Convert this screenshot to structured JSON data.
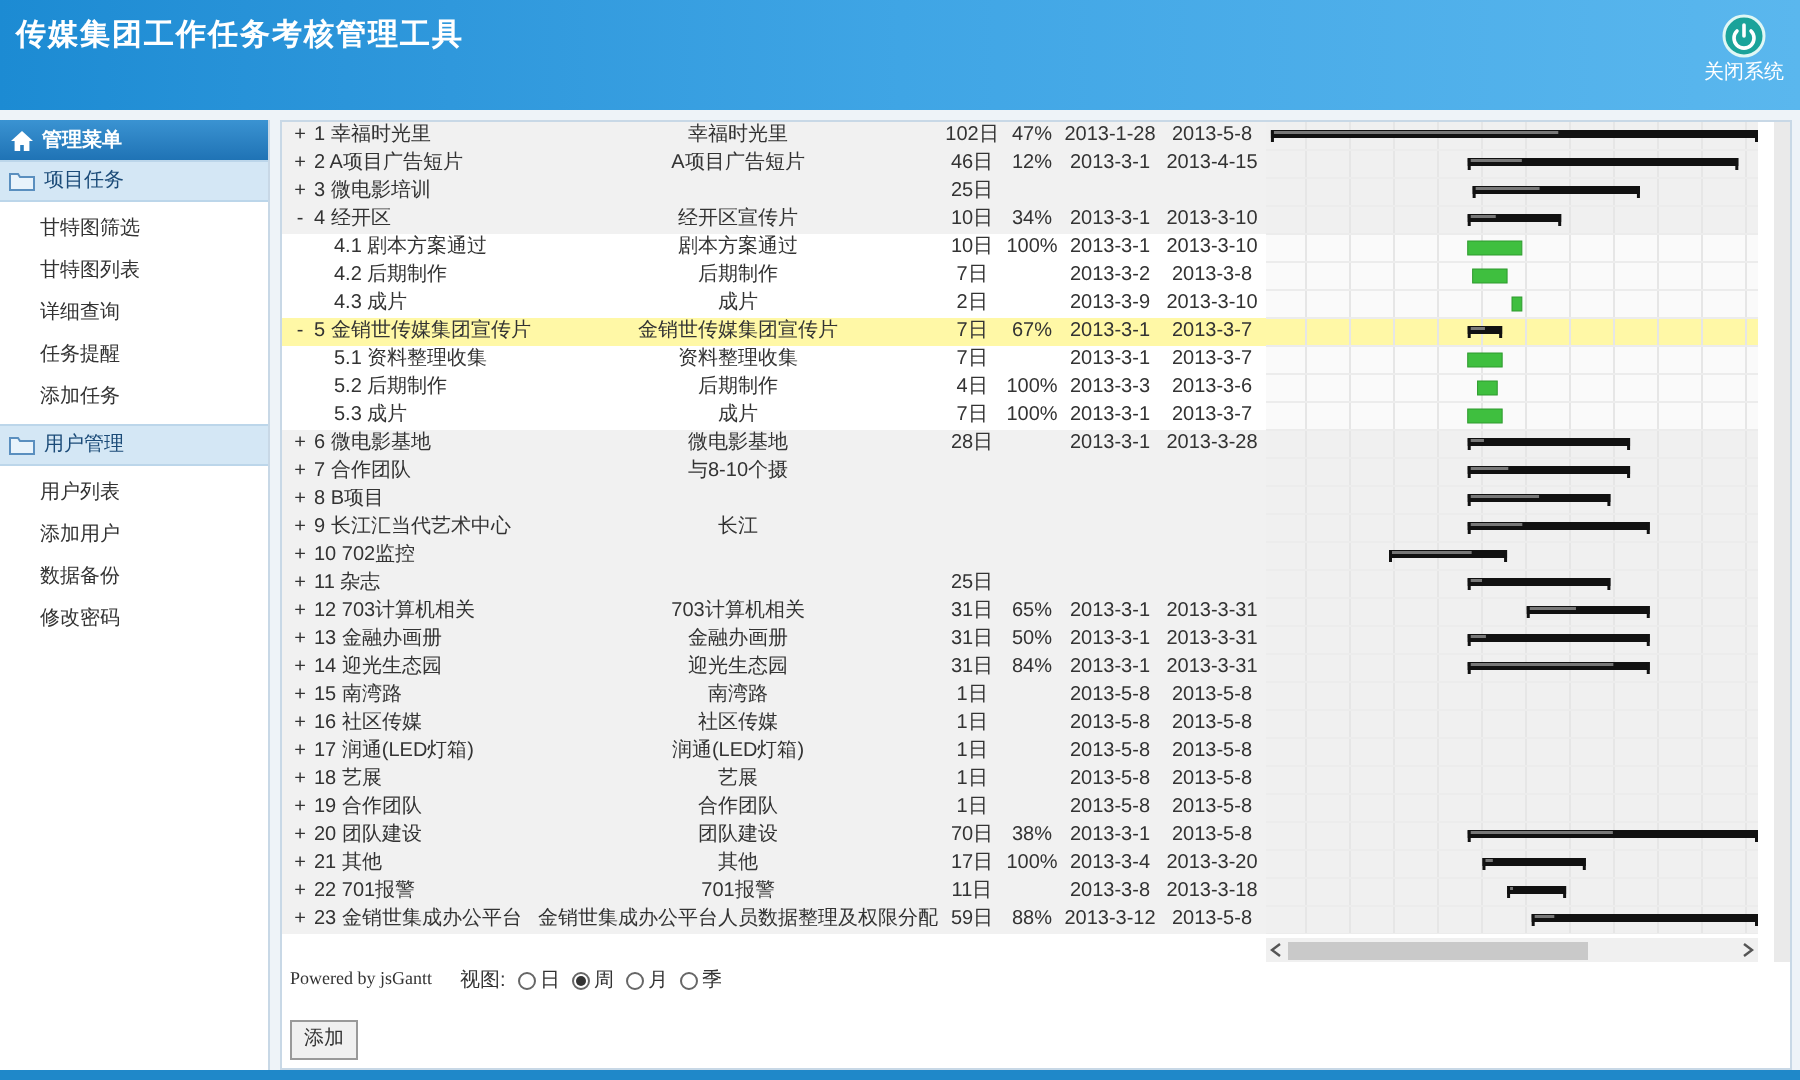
{
  "header": {
    "title": "传媒集团工作任务考核管理工具",
    "close_label": "关闭系统"
  },
  "sidebar": {
    "title": "管理菜单",
    "groups": [
      {
        "title": "项目任务",
        "items": [
          "甘特图筛选",
          "甘特图列表",
          "详细查询",
          "任务提醒",
          "添加任务"
        ]
      },
      {
        "title": "用户管理",
        "items": [
          "用户列表",
          "添加用户",
          "数据备份",
          "修改密码"
        ]
      }
    ]
  },
  "tasks": [
    {
      "toggle": "+",
      "label": "1 幸福时光里",
      "desc": "幸福时光里",
      "duration": "102日",
      "percent": "47%",
      "start": "2013-1-28",
      "end": "2013-5-8",
      "selected": false
    },
    {
      "toggle": "+",
      "label": "2 A项目广告短片",
      "desc": "A项目广告短片",
      "duration": "46日",
      "percent": "12%",
      "start": "2013-3-1",
      "end": "2013-4-15",
      "selected": false
    },
    {
      "toggle": "+",
      "label": "3 微电影培训",
      "duration": "25日",
      "selected": false
    },
    {
      "toggle": "-",
      "label": "4 经开区",
      "desc": "经开区宣传片",
      "duration": "10日",
      "percent": "34%",
      "start": "2013-3-1",
      "end": "2013-3-10",
      "selected": false,
      "children": [
        {
          "label": "4.1 剧本方案通过",
          "desc": "剧本方案通过",
          "duration": "10日",
          "percent": "100%",
          "start": "2013-3-1",
          "end": "2013-3-10",
          "selected": false
        },
        {
          "label": "4.2 后期制作",
          "desc": "后期制作",
          "duration": "7日",
          "start": "2013-3-2",
          "end": "2013-3-8",
          "selected": false
        },
        {
          "label": "4.3 成片",
          "desc": "成片",
          "duration": "2日",
          "start": "2013-3-9",
          "end": "2013-3-10",
          "selected": false
        }
      ]
    },
    {
      "toggle": "-",
      "label": "5 金销世传媒集团宣传片",
      "desc": "金销世传媒集团宣传片",
      "duration": "7日",
      "percent": "67%",
      "start": "2013-3-1",
      "end": "2013-3-7",
      "selected": true,
      "children": [
        {
          "label": "5.1 资料整理收集",
          "desc": "资料整理收集",
          "duration": "7日",
          "start": "2013-3-1",
          "end": "2013-3-7",
          "selected": false
        },
        {
          "label": "5.2 后期制作",
          "desc": "后期制作",
          "duration": "4日",
          "percent": "100%",
          "start": "2013-3-3",
          "end": "2013-3-6",
          "selected": false
        },
        {
          "label": "5.3 成片",
          "desc": "成片",
          "duration": "7日",
          "percent": "100%",
          "start": "2013-3-1",
          "end": "2013-3-7",
          "selected": false
        }
      ]
    },
    {
      "toggle": "+",
      "label": "6 微电影基地",
      "desc": "微电影基地",
      "duration": "28日",
      "start": "2013-3-1",
      "end": "2013-3-28",
      "selected": false
    },
    {
      "toggle": "+",
      "label": "7 合作团队",
      "desc": "与8-10个摄",
      "selected": false
    },
    {
      "toggle": "+",
      "label": "8 B项目",
      "selected": false
    },
    {
      "toggle": "+",
      "label": "9 长江汇当代艺术中心",
      "desc": "长江",
      "selected": false
    },
    {
      "toggle": "+",
      "label": "10 702监控",
      "selected": false
    },
    {
      "toggle": "+",
      "label": "11 杂志",
      "duration": "25日",
      "selected": false
    },
    {
      "toggle": "+",
      "label": "12 703计算机相关",
      "desc": "703计算机相关",
      "duration": "31日",
      "percent": "65%",
      "start": "2013-3-1",
      "end": "2013-3-31",
      "selected": false
    },
    {
      "toggle": "+",
      "label": "13 金融办画册",
      "desc": "金融办画册",
      "duration": "31日",
      "percent": "50%",
      "start": "2013-3-1",
      "end": "2013-3-31",
      "selected": false
    },
    {
      "toggle": "+",
      "label": "14 迎光生态园",
      "desc": "迎光生态园",
      "duration": "31日",
      "percent": "84%",
      "start": "2013-3-1",
      "end": "2013-3-31",
      "selected": false
    },
    {
      "toggle": "+",
      "label": "15 南湾路",
      "desc": "南湾路",
      "duration": "1日",
      "start": "2013-5-8",
      "end": "2013-5-8",
      "selected": false
    },
    {
      "toggle": "+",
      "label": "16 社区传媒",
      "desc": "社区传媒",
      "duration": "1日",
      "start": "2013-5-8",
      "end": "2013-5-8",
      "selected": false
    },
    {
      "toggle": "+",
      "label": "17 润通(LED灯箱)",
      "desc": "润通(LED灯箱)",
      "duration": "1日",
      "start": "2013-5-8",
      "end": "2013-5-8",
      "selected": false
    },
    {
      "toggle": "+",
      "label": "18 艺展",
      "desc": "艺展",
      "duration": "1日",
      "start": "2013-5-8",
      "end": "2013-5-8",
      "selected": false
    },
    {
      "toggle": "+",
      "label": "19 合作团队",
      "desc": "合作团队",
      "duration": "1日",
      "start": "2013-5-8",
      "end": "2013-5-8",
      "selected": false
    },
    {
      "toggle": "+",
      "label": "20 团队建设",
      "desc": "团队建设",
      "duration": "70日",
      "percent": "38%",
      "start": "2013-3-1",
      "end": "2013-5-8",
      "selected": false
    },
    {
      "toggle": "+",
      "label": "21 其他",
      "desc": "其他",
      "duration": "17日",
      "percent": "100%",
      "start": "2013-3-4",
      "end": "2013-3-20",
      "selected": false
    },
    {
      "toggle": "+",
      "label": "22 701报警",
      "desc": "701报警",
      "duration": "11日",
      "start": "2013-3-8",
      "end": "2013-3-18",
      "selected": false
    },
    {
      "toggle": "+",
      "label": "23 金销世集成办公平台",
      "desc": "金销世集成办公平台人员数据整理及权限分配",
      "duration": "59日",
      "percent": "88%",
      "start": "2013-3-12",
      "end": "2013-5-8",
      "selected": false
    }
  ],
  "footer": {
    "powered": "Powered by jsGantt",
    "view_label": "视图:",
    "views": [
      {
        "label": "日",
        "selected": false
      },
      {
        "label": "周",
        "selected": true
      },
      {
        "label": "月",
        "selected": false
      },
      {
        "label": "季",
        "selected": false
      }
    ]
  },
  "add_button": "添加"
}
